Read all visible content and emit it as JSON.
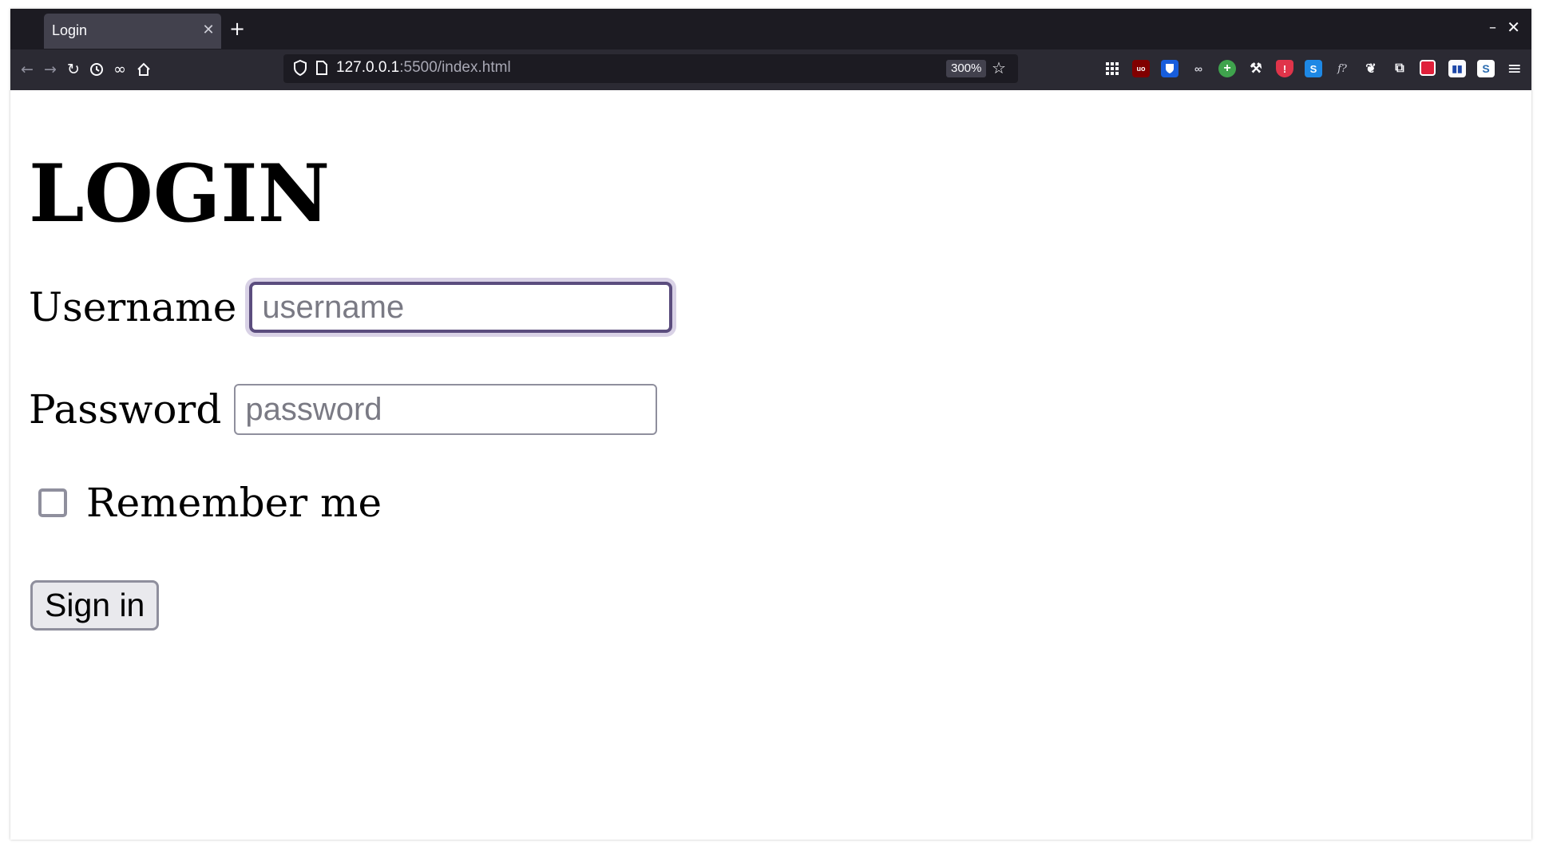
{
  "browser": {
    "tab_title": "Login",
    "url_host": "127.0.0.1",
    "url_rest": ":5500/index.html",
    "zoom": "300%"
  },
  "page": {
    "heading": "LOGIN",
    "username_label": "Username",
    "username_placeholder": "username",
    "username_value": "",
    "password_label": "Password",
    "password_placeholder": "password",
    "password_value": "",
    "remember_label": "Remember me",
    "remember_checked": false,
    "signin_label": "Sign in"
  },
  "icons": {
    "nav": [
      "back-icon",
      "forward-icon",
      "reload-icon",
      "history-icon",
      "infinity-icon",
      "home-icon"
    ],
    "extensions": [
      "grid-icon",
      "ublock-icon",
      "bitwarden-icon",
      "glasses-icon",
      "plus-circle-icon",
      "wrench-icon",
      "shield-ext-icon",
      "s-ext-icon",
      "font-finder-icon",
      "bird-icon",
      "puzzle-icon",
      "red-square-icon",
      "tile-icon",
      "stylus-icon",
      "menu-icon"
    ]
  }
}
